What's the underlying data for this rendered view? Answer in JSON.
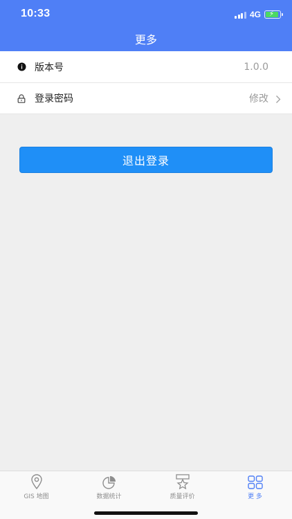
{
  "status_bar": {
    "time": "10:33",
    "network": "4G"
  },
  "header": {
    "title": "更多"
  },
  "list": {
    "version": {
      "label": "版本号",
      "value": "1.0.0",
      "icon": "info-icon"
    },
    "password": {
      "label": "登录密码",
      "action": "修改",
      "icon": "lock-icon"
    }
  },
  "logout_button": {
    "label": "退出登录"
  },
  "tabbar": {
    "tabs": [
      {
        "label": "GIS 地图",
        "icon": "map-pin-icon",
        "active": false
      },
      {
        "label": "数据统计",
        "icon": "pie-chart-icon",
        "active": false
      },
      {
        "label": "质量评价",
        "icon": "star-badge-icon",
        "active": false
      },
      {
        "label": "更 多",
        "icon": "grid-icon",
        "active": true
      }
    ]
  },
  "colors": {
    "header": "#4f7ff6",
    "logout_button": "#1f8ff7",
    "active_tab": "#4f7ff6",
    "inactive_tab": "#8e8e8e",
    "background": "#efefef"
  }
}
